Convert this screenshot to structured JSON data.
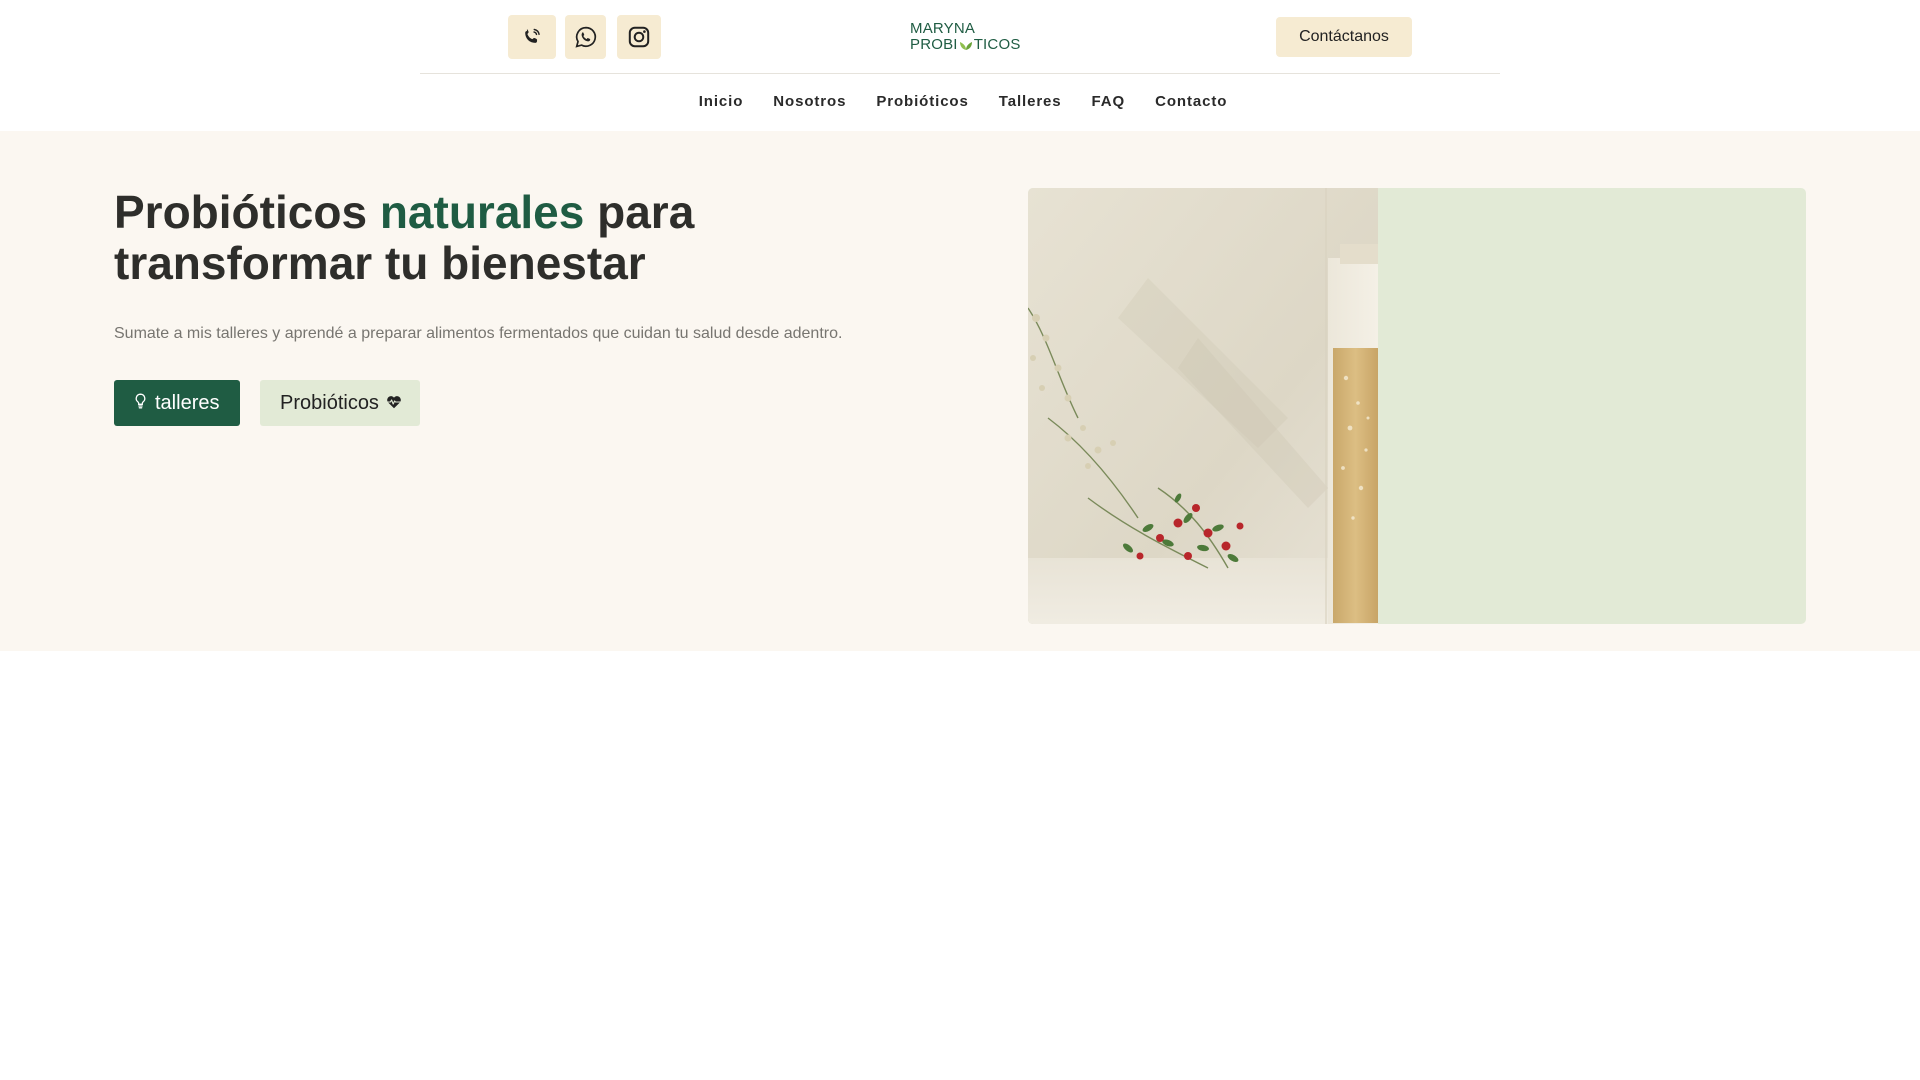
{
  "header": {
    "social": [
      {
        "name": "phone-icon",
        "label": "Teléfono"
      },
      {
        "name": "whatsapp-icon",
        "label": "WhatsApp"
      },
      {
        "name": "instagram-icon",
        "label": "Instagram"
      }
    ],
    "logo": {
      "line1": "MARYNA",
      "line2_a": "PROBI",
      "line2_b": "TICOS"
    },
    "contact_label": "Contáctanos"
  },
  "nav": {
    "items": [
      "Inicio",
      "Nosotros",
      "Probióticos",
      "Talleres",
      "FAQ",
      "Contacto"
    ]
  },
  "hero": {
    "title_a": "Probióticos ",
    "title_accent": "naturales",
    "title_b": " para transformar tu bienestar",
    "subtitle": "Sumate a mis talleres y aprendé a preparar alimentos fermentados que cuidan tu salud desde adentro.",
    "primary_button": "talleres",
    "secondary_button": "Probióticos"
  },
  "colors": {
    "brand_green": "#1f5c43",
    "accent_cream": "#f6ebd2",
    "hero_bg": "#fbf7f1",
    "light_green": "#e2ead6"
  }
}
